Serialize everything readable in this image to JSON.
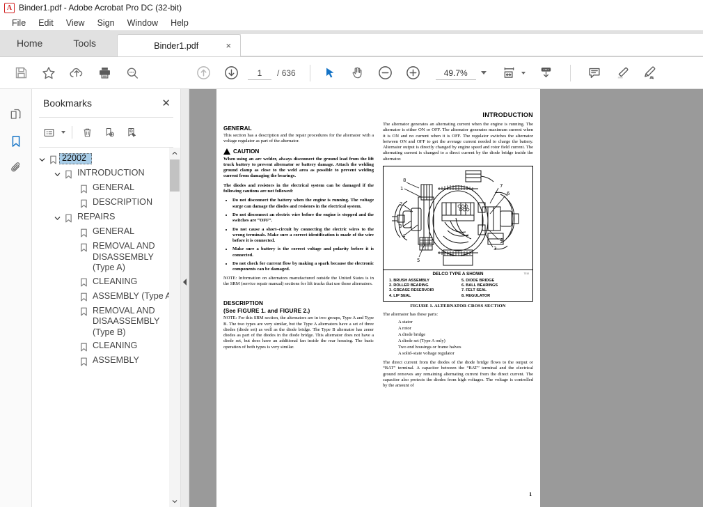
{
  "window": {
    "title": "Binder1.pdf - Adobe Acrobat Pro DC (32-bit)",
    "app_icon": "acrobat-icon"
  },
  "menu": {
    "items": [
      "File",
      "Edit",
      "View",
      "Sign",
      "Window",
      "Help"
    ]
  },
  "tabs": {
    "home_label": "Home",
    "tools_label": "Tools",
    "document": {
      "label": "Binder1.pdf",
      "close": "×"
    }
  },
  "toolbar": {
    "save_tooltip": "Save",
    "star_tooltip": "Add to Favorites",
    "upload_tooltip": "Send file",
    "print_tooltip": "Print file",
    "find_tooltip": "Find",
    "prev_page_tooltip": "Previous Page",
    "next_page_tooltip": "Next Page",
    "page_current": "1",
    "page_separator": "/",
    "page_total": "636",
    "select_tool_tooltip": "Select tool",
    "hand_tool_tooltip": "Hand tool",
    "zoom_out_tooltip": "Zoom out",
    "zoom_in_tooltip": "Zoom in",
    "zoom_level": "49.7%",
    "fit_tooltip": "Fit page",
    "scroll_mode_tooltip": "Page display",
    "comment_tooltip": "Add comment",
    "highlight_tooltip": "Highlight text",
    "sign_tooltip": "Sign"
  },
  "rail": {
    "thumbnails": "page-thumbnails-icon",
    "bookmarks": "bookmarks-icon",
    "attachments": "attachments-icon",
    "active": "bookmarks"
  },
  "bookmarks_panel": {
    "title": "Bookmarks",
    "close": "✕",
    "toolbar": {
      "options": "options-list-icon",
      "delete": "trash-icon",
      "new_bookmark": "new-bookmark-icon",
      "edit_bookmark": "edit-bookmark-icon"
    },
    "items": [
      {
        "label": "22002",
        "depth": 0,
        "twisty": "expanded",
        "selected": true
      },
      {
        "label": "INTRODUCTION",
        "depth": 1,
        "twisty": "expanded",
        "selected": false
      },
      {
        "label": "GENERAL",
        "depth": 2,
        "twisty": "none",
        "selected": false
      },
      {
        "label": "DESCRIPTION",
        "depth": 2,
        "twisty": "none",
        "selected": false
      },
      {
        "label": "REPAIRS",
        "depth": 1,
        "twisty": "expanded",
        "selected": false
      },
      {
        "label": "GENERAL",
        "depth": 2,
        "twisty": "none",
        "selected": false
      },
      {
        "label": "REMOVAL AND DISASSEMBLY (Type A)",
        "depth": 2,
        "twisty": "none",
        "selected": false
      },
      {
        "label": "CLEANING",
        "depth": 2,
        "twisty": "none",
        "selected": false
      },
      {
        "label": "ASSEMBLY (Type A)",
        "depth": 2,
        "twisty": "none",
        "selected": false
      },
      {
        "label": "REMOVAL AND DISAASSEMBLY (Type B)",
        "depth": 2,
        "twisty": "none",
        "selected": false
      },
      {
        "label": "CLEANING",
        "depth": 2,
        "twisty": "none",
        "selected": false
      },
      {
        "label": "ASSEMBLY",
        "depth": 2,
        "twisty": "none",
        "selected": false
      }
    ]
  },
  "document": {
    "header": "INTRODUCTION",
    "left_column": {
      "general_heading": "GENERAL",
      "general_text": "This section has a description and the repair procedures for the alternator with a voltage regulator as part of the alternator.",
      "caution_label": "CAUTION",
      "caution_text": "When using an arc welder, always disconnect the ground lead from the lift truck battery to prevent alternator or battery damage. Attach the welding ground clamp as close to the weld area as possible to prevent welding current from damaging the bearings.",
      "diodes_text": "The diodes and resistors in the electrical system can be damaged if the following cautions are not followed:",
      "bullets": [
        "Do not disconnect the battery when the engine is running. The voltage surge can damage the diodes and resistors in the electrical system.",
        "Do not disconnect an electric wire before the engine is stopped and the switches are “OFF”.",
        "Do not cause a short–circuit by connecting the electric wires to the wrong terminals. Make sure a correct identification is made of the wire before it is connected.",
        "Make sure a battery is the correct voltage and polarity before it is connected.",
        "Do not check for current flow by making a spark because the electronic components can be damaged."
      ],
      "note1": "NOTE: Information on alternators manufactured outside the United States is in the SRM (service repair manual) sections for lift trucks that use those alternators.",
      "description_heading": "DESCRIPTION",
      "description_subheading": "(See FIGURE 1. and FIGURE 2.)",
      "note2": "NOTE: For this SRM section, the alternators are in two groups, Type A and Type B. The two types are very similar, but the Type A alternators have a set of three diodes (diode set) as well as the diode bridge. The Type B alternator has zener diodes as part of the diodes in the diode bridge. This alternator does not have a diode set, but does have an additional fan inside the rear housing. The basic operation of both types is very similar."
    },
    "right_column": {
      "para1": "The alternator generates an alternating current when the engine is running. The alternator is either ON or OFF. The alternator generates maximum current when it is ON and no current when it is OFF. The regulator switches the alternator between ON and OFF to get the average current needed to charge the battery. Alternator output is directly changed by engine speed and rotor field current. The alternating current is changed to a direct current by the diode bridge inside the alternator.",
      "figure": {
        "image_alt": "alternator-cross-section-drawing",
        "title": "DELCO TYPE A SHOWN",
        "tiny_id": "7010",
        "legend_left": [
          "1. BRUSH ASSEMBLY",
          "2. ROLLER BEARING",
          "3. GREASE RESERVOIR",
          "4. LIP SEAL"
        ],
        "legend_right": [
          "5. DIODE BRIDGE",
          "6. BALL BEARINGS",
          "7. FELT SEAL",
          "8. REGULATOR"
        ],
        "caption": "FIGURE 1. ALTERNATOR CROSS SECTION"
      },
      "parts_intro": "The alternator has these parts:",
      "parts": [
        "A stator",
        "A rotor",
        "A diode bridge",
        "A diode set (Type A only)",
        "Two end housings or frame halves",
        "A solid–state voltage regulator"
      ],
      "para2": "The direct current from the diodes of the diode bridge flows to the output or “BAT” terminal. A capacitor between the “BAT” terminal and the electrical ground removes any remaining alternating current from the direct current. The capacitor also protects the diodes from high voltages. The voltage is controlled by the amount of",
      "page_number": "1"
    }
  },
  "colors": {
    "accent": "#1473c6",
    "selection": "#a8cde8",
    "viewer_bg": "#9a9a9a",
    "tabstrip_bg": "#e1e1e1"
  }
}
